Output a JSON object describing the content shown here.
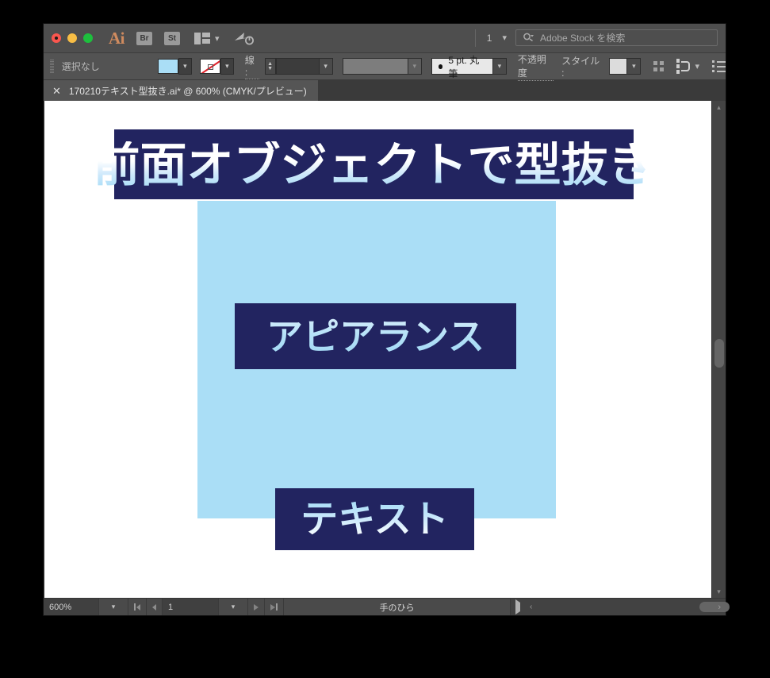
{
  "window": {
    "app_name": "Ai",
    "bridge_button": "Br",
    "stock_button": "St",
    "document_count": "1",
    "stock_search_placeholder": "Adobe Stock を検索"
  },
  "control_bar": {
    "selection_label": "選択なし",
    "fill_color": "#aadef6",
    "stroke_color": "none",
    "stroke_label": "線 :",
    "stroke_weight": "",
    "brush_label": "5 pt. 丸筆",
    "opacity_label": "不透明度",
    "style_label": "スタイル :",
    "style_swatch_color": "#dcdcdc"
  },
  "tab": {
    "close_glyph": "✕",
    "title": "170210テキスト型抜き.ai* @ 600% (CMYK/プレビュー)"
  },
  "artwork": {
    "navy": "#222460",
    "light_blue": "#aadef6",
    "title_text": "前面オブジェクトで型抜き",
    "middle_text": "アピアランス",
    "bottom_text": "テキスト"
  },
  "status_bar": {
    "zoom": "600%",
    "page_number": "1",
    "active_tool": "手のひら"
  }
}
